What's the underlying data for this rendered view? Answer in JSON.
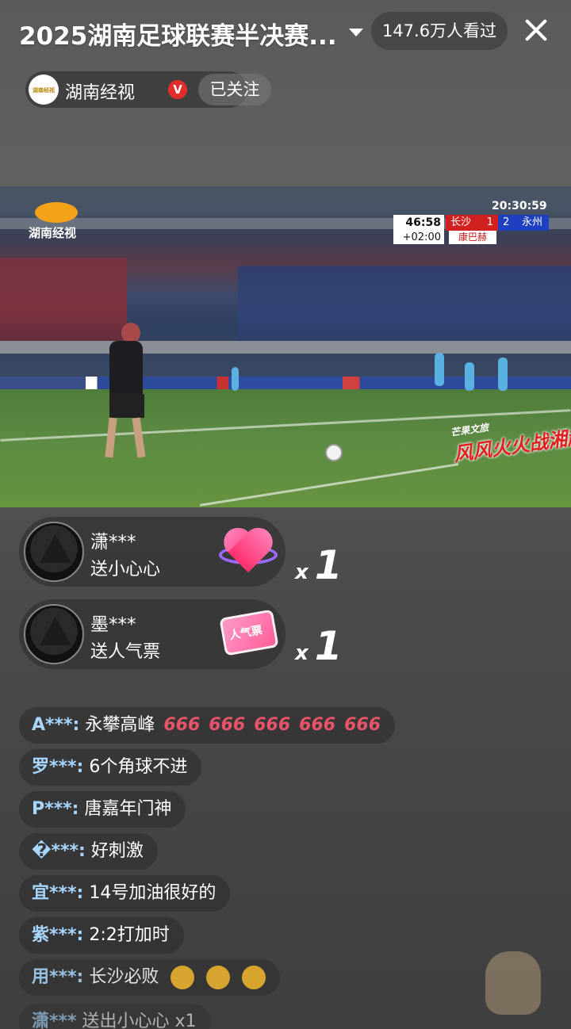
{
  "header": {
    "title": "2025湖南足球联赛半决赛...",
    "viewers": "147.6万人看过"
  },
  "channel": {
    "name": "湖南经视",
    "logo_text": "湖南经视",
    "verified_badge": "V",
    "follow_label": "已关注"
  },
  "video": {
    "station_logo": "湖南经视",
    "clock": "20:30:59",
    "scoreboard": {
      "match_time": "46:58",
      "added_time": "+02:00",
      "home_team": "长沙",
      "home_score": "1",
      "away_score": "2",
      "away_team": "永州",
      "sponsor": "康巴赫"
    },
    "watermark_top": "芒果文旅",
    "watermark_main": "风风火火战湘超"
  },
  "gifts": [
    {
      "user": "潇***",
      "action": "送小心心",
      "gift_icon": "heart-gift-icon",
      "multiplier": "x",
      "count": "1"
    },
    {
      "user": "墨***",
      "action": "送人气票",
      "gift_icon": "ticket-gift-icon",
      "ticket_text": "人气票",
      "multiplier": "x",
      "count": "1"
    }
  ],
  "chat": [
    {
      "name": "A***:",
      "text": "永攀高峰",
      "emotes": [
        "666",
        "666",
        "666",
        "666",
        "666"
      ]
    },
    {
      "name": "罗***:",
      "text": "6个角球不进"
    },
    {
      "name": "P***:",
      "text": "唐嘉年门神"
    },
    {
      "name": "�***:",
      "text": "好刺激"
    },
    {
      "name": "宜***:",
      "text": "14号加油很好的"
    },
    {
      "name": "紫***:",
      "text": "2:2打加时"
    },
    {
      "name": "用***:",
      "text": "长沙必败",
      "claps": 3
    },
    {
      "name": "潇***",
      "text": "送出小心心",
      "suffix": "x1"
    }
  ],
  "colors": {
    "accent_red": "#e62b2b",
    "home_team": "#d02020",
    "away_team": "#1e3fbf",
    "chat_name": "#a8d8ff"
  }
}
